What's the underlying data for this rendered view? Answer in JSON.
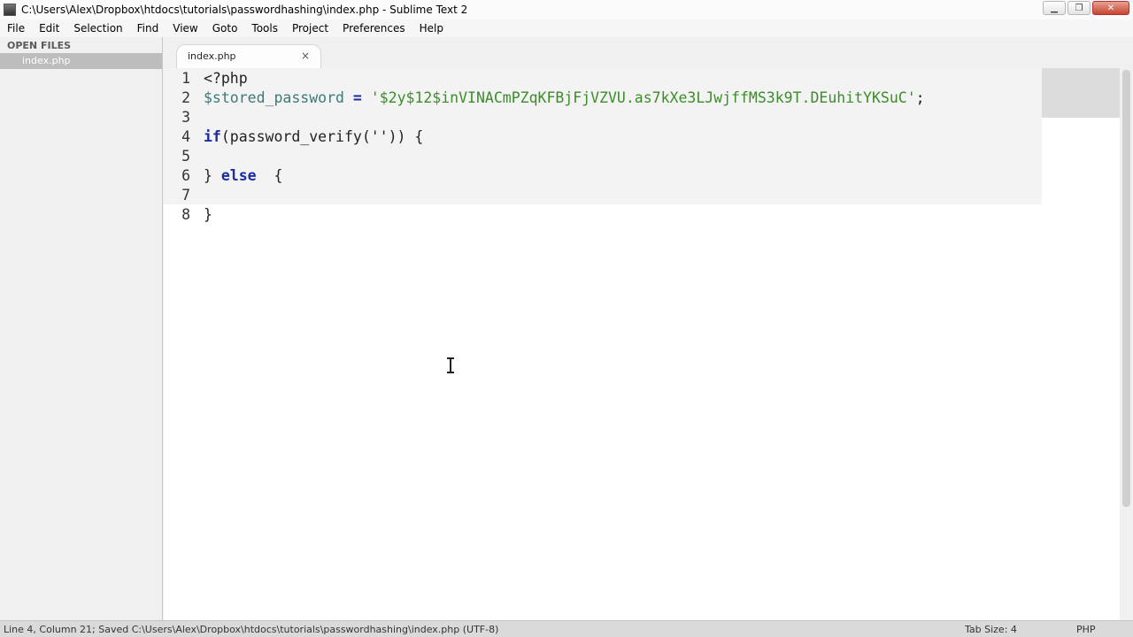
{
  "window": {
    "title": "C:\\Users\\Alex\\Dropbox\\htdocs\\tutorials\\passwordhashing\\index.php - Sublime Text 2",
    "minimize_glyph": "▁",
    "maximize_glyph": "❐",
    "close_glyph": "✕"
  },
  "menu": [
    "File",
    "Edit",
    "Selection",
    "Find",
    "View",
    "Goto",
    "Tools",
    "Project",
    "Preferences",
    "Help"
  ],
  "sidebar": {
    "heading": "OPEN FILES",
    "files": [
      "index.php"
    ]
  },
  "tabs": [
    {
      "label": "index.php",
      "close_glyph": "×"
    }
  ],
  "editor": {
    "lines": [
      {
        "num": "1",
        "parts": [
          {
            "t": "<?php",
            "c": ""
          }
        ]
      },
      {
        "num": "2",
        "parts": [
          {
            "t": "$stored_password",
            "c": "var"
          },
          {
            "t": " ",
            "c": ""
          },
          {
            "t": "=",
            "c": "op"
          },
          {
            "t": " ",
            "c": ""
          },
          {
            "t": "'$2y$12$inVINACmPZqKFBjFjVZVU.as7kXe3LJwjffMS3k9T.DEuhitYKSuC'",
            "c": "str"
          },
          {
            "t": ";",
            "c": ""
          }
        ]
      },
      {
        "num": "3",
        "parts": []
      },
      {
        "num": "4",
        "parts": [
          {
            "t": "if",
            "c": "kw"
          },
          {
            "t": "(password_verify('')) {",
            "c": ""
          }
        ]
      },
      {
        "num": "5",
        "parts": []
      },
      {
        "num": "6",
        "parts": [
          {
            "t": "} ",
            "c": ""
          },
          {
            "t": "else",
            "c": "kw"
          },
          {
            "t": "  {",
            "c": ""
          }
        ]
      },
      {
        "num": "7",
        "parts": []
      },
      {
        "num": "8",
        "parts": [
          {
            "t": "}",
            "c": ""
          }
        ]
      }
    ],
    "active_line": "4"
  },
  "status": {
    "left": "Line 4, Column 21; Saved C:\\Users\\Alex\\Dropbox\\htdocs\\tutorials\\passwordhashing\\index.php (UTF-8)",
    "tab_size": "Tab Size: 4",
    "syntax": "PHP"
  },
  "colors": {
    "keyword": "#1a2ba3",
    "variable": "#3a7a78",
    "string": "#3c8d2a",
    "sidebar_selected": "#bdbdbd"
  }
}
